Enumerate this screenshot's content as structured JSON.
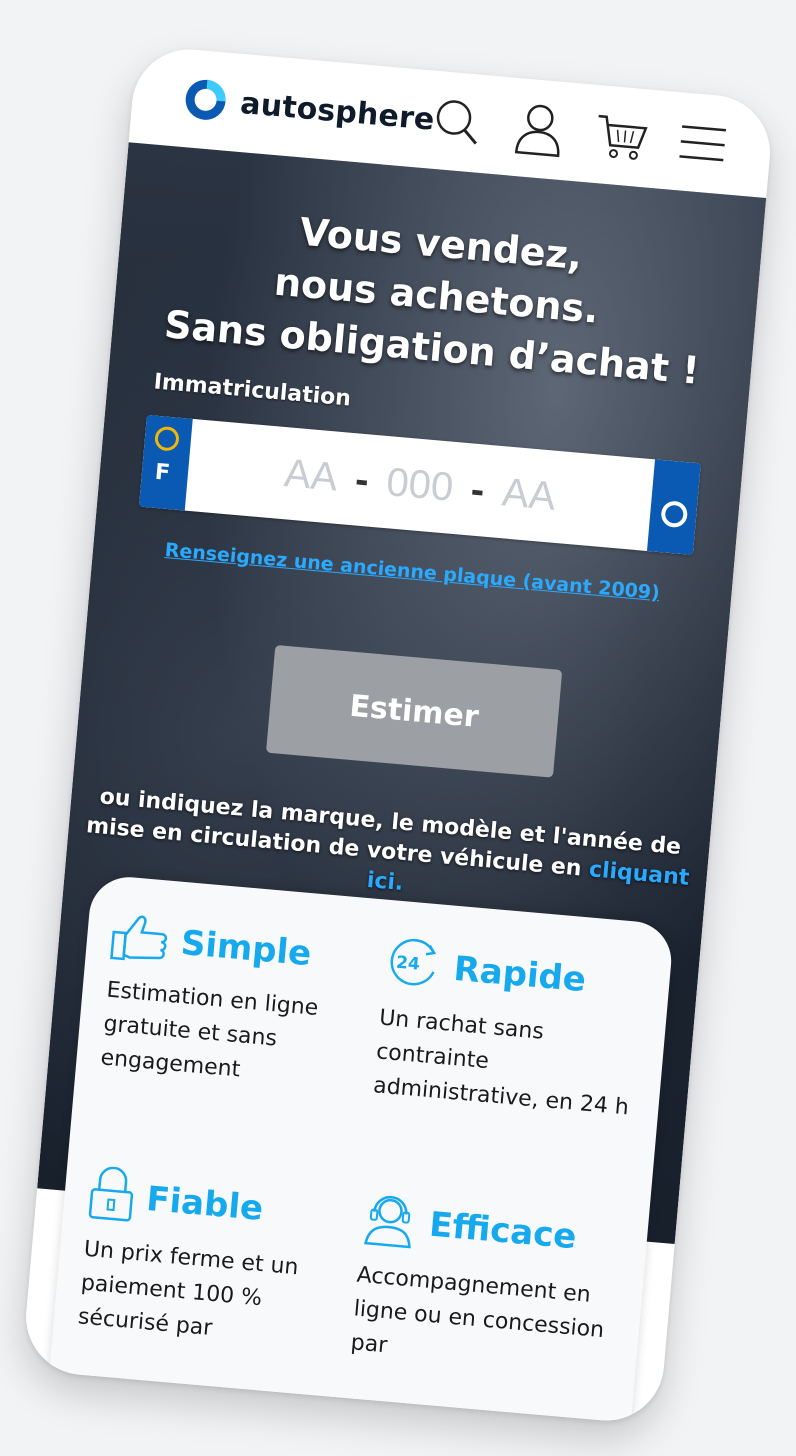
{
  "brand": {
    "name": "autosphere",
    "primary_color": "#0a5ab4",
    "accent_color": "#16a9ee"
  },
  "nav": {
    "icons": [
      "search-icon",
      "user-icon",
      "cart-icon",
      "menu-icon"
    ]
  },
  "hero": {
    "title_line1": "Vous vendez,",
    "title_line2": "nous achetons.",
    "title_line3": "Sans obligation d’achat !",
    "plate_label": "Immatriculation",
    "plate_country": "F",
    "plate_part1": "AA",
    "plate_part2": "000",
    "plate_part3": "AA",
    "plate_dash": "-",
    "old_plate_link": "Renseignez une ancienne plaque (avant 2009)",
    "estimate_button": "Estimer",
    "alt_text_before": "ou indiquez la marque, le modèle et l'année de mise en circulation de votre véhicule en ",
    "alt_text_link": "cliquant ici."
  },
  "features": [
    {
      "title": "Simple",
      "icon": "thumbs-up-icon",
      "text": "Estimation en ligne gratuite et sans engagement"
    },
    {
      "title": "Rapide",
      "icon": "24h-icon",
      "text": "Un rachat sans contrainte administrative, en 24 h"
    },
    {
      "title": "Fiable",
      "icon": "lock-icon",
      "text": "Un prix ferme et un paiement 100 % sécurisé par"
    },
    {
      "title": "Efficace",
      "icon": "headset-icon",
      "text": "Accompagnement en ligne ou en concession par"
    }
  ]
}
